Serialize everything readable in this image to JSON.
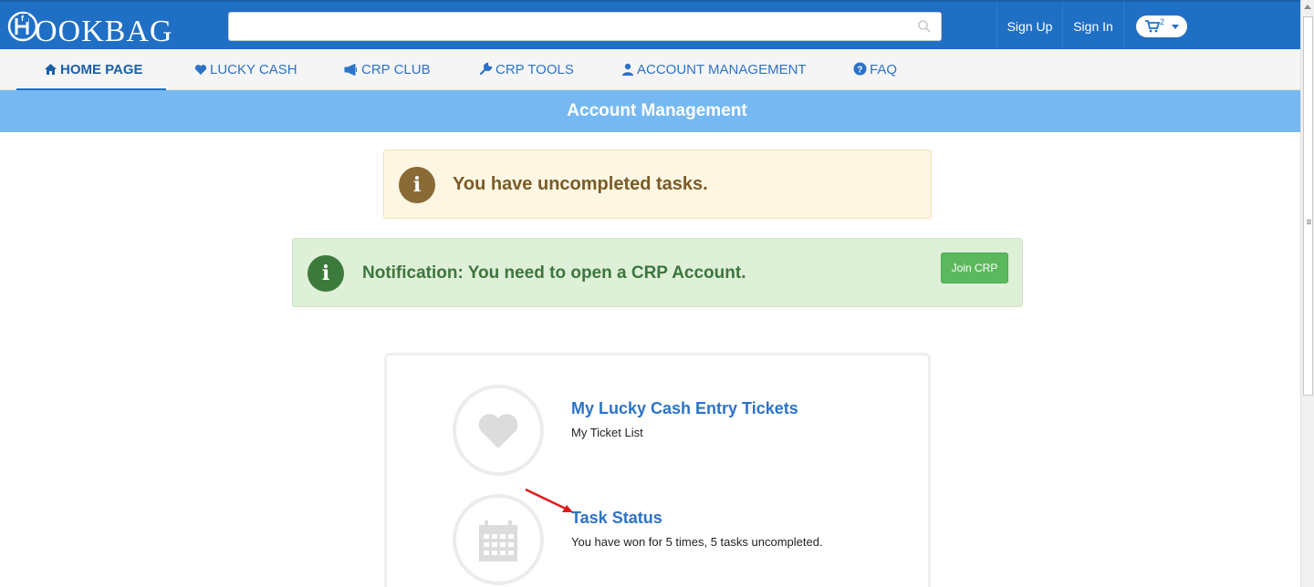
{
  "header": {
    "logo_text": "OOKBAG",
    "search_placeholder": "",
    "sign_up": "Sign Up",
    "sign_in": "Sign In",
    "cart_count": "2",
    "brand_color": "#1f6fc5"
  },
  "nav": {
    "items": [
      {
        "label": "HOME PAGE",
        "icon": "home-icon",
        "active": true
      },
      {
        "label": "LUCKY CASH",
        "icon": "heart-icon",
        "active": false
      },
      {
        "label": "CRP CLUB",
        "icon": "megaphone-icon",
        "active": false
      },
      {
        "label": "CRP TOOLS",
        "icon": "wrench-icon",
        "active": false
      },
      {
        "label": "ACCOUNT MANAGEMENT",
        "icon": "user-icon",
        "active": false
      },
      {
        "label": "FAQ",
        "icon": "question-circle-icon",
        "active": false
      }
    ]
  },
  "page": {
    "title": "Account Management"
  },
  "alerts": {
    "warning_text": "You have uncompleted tasks.",
    "notification_text": "Notification: You need to open a CRP Account.",
    "join_button": "Join CRP"
  },
  "panel": {
    "items": [
      {
        "title": "My Lucky Cash Entry Tickets",
        "subtitle": "My Ticket List",
        "icon": "heart-icon"
      },
      {
        "title": "Task Status",
        "subtitle": "You have won for 5 times, 5 tasks uncompleted.",
        "icon": "calendar-icon"
      }
    ]
  }
}
